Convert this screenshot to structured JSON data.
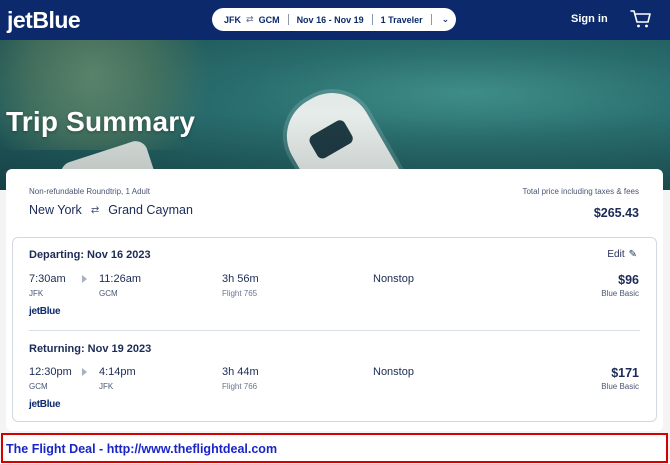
{
  "header": {
    "logo": "jetBlue",
    "search": {
      "from": "JFK",
      "to": "GCM",
      "dates": "Nov 16 - Nov 19",
      "travelers": "1 Traveler"
    },
    "signin_label": "Sign in",
    "icons": {
      "swap": "swap-arrows-icon",
      "dropdown": "chevron-down-icon",
      "cart": "cart-icon"
    }
  },
  "hero": {
    "title": "Trip Summary"
  },
  "summary": {
    "subtitle": "Non-refundable Roundtrip, 1 Adult",
    "origin": "New York",
    "destination": "Grand Cayman",
    "total_label": "Total price including taxes & fees",
    "total_price": "$265.43"
  },
  "departing": {
    "heading": "Departing: Nov 16 2023",
    "edit_label": "Edit",
    "depart_time": "7:30am",
    "depart_airport": "JFK",
    "arrive_time": "11:26am",
    "arrive_airport": "GCM",
    "duration": "3h 56m",
    "flight": "Flight 765",
    "stops": "Nonstop",
    "price": "$96",
    "fare": "Blue Basic",
    "airline": "jetBlue"
  },
  "returning": {
    "heading": "Returning: Nov 19 2023",
    "depart_time": "12:30pm",
    "depart_airport": "GCM",
    "arrive_time": "4:14pm",
    "arrive_airport": "JFK",
    "duration": "3h 44m",
    "flight": "Flight 766",
    "stops": "Nonstop",
    "price": "$171",
    "fare": "Blue Basic",
    "airline": "jetBlue"
  },
  "banner": {
    "text": "The Flight Deal - http://www.theflightdeal.com"
  },
  "colors": {
    "navy": "#0c2a6b",
    "text": "#1b2b56",
    "banner_border": "#d40000",
    "banner_text": "#1a25c8"
  }
}
